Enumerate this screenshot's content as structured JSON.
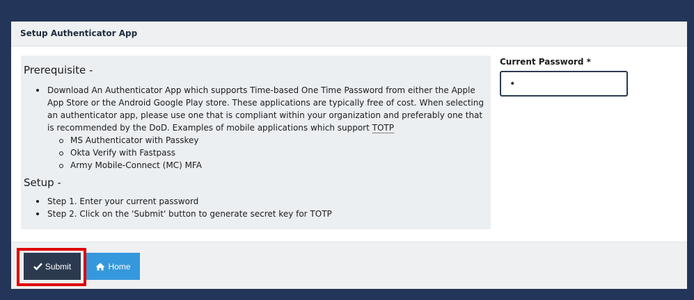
{
  "card": {
    "title": "Setup Authenticator App"
  },
  "prereq": {
    "heading": "Prerequisite -",
    "bullet_text": "Download An Authenticator App which supports Time-based One Time Password from either the Apple App Store or the Android Google Play store. These applications are typically free of cost. When selecting an authenticator app, please use one that is compliant within your organization and preferably one that is recommended by the DoD. Examples of mobile applications which support ",
    "abbr": "TOTP",
    "apps": [
      "MS Authenticator with Passkey",
      "Okta Verify with Fastpass",
      "Army Mobile-Connect (MC) MFA"
    ]
  },
  "setup": {
    "heading": "Setup -",
    "steps": [
      "Step 1. Enter your current password",
      "Step 2. Click on the 'Submit' button to generate secret key for TOTP"
    ]
  },
  "password": {
    "label": "Current Password *",
    "value": "•"
  },
  "footer": {
    "submit_label": "Submit",
    "home_label": "Home"
  },
  "icons": {
    "submit": "check-icon",
    "home": "home-icon"
  },
  "colors": {
    "page_bg": "#233558",
    "submit_bg": "#2b3a4f",
    "home_bg": "#3598dc",
    "highlight": "#e00000"
  }
}
